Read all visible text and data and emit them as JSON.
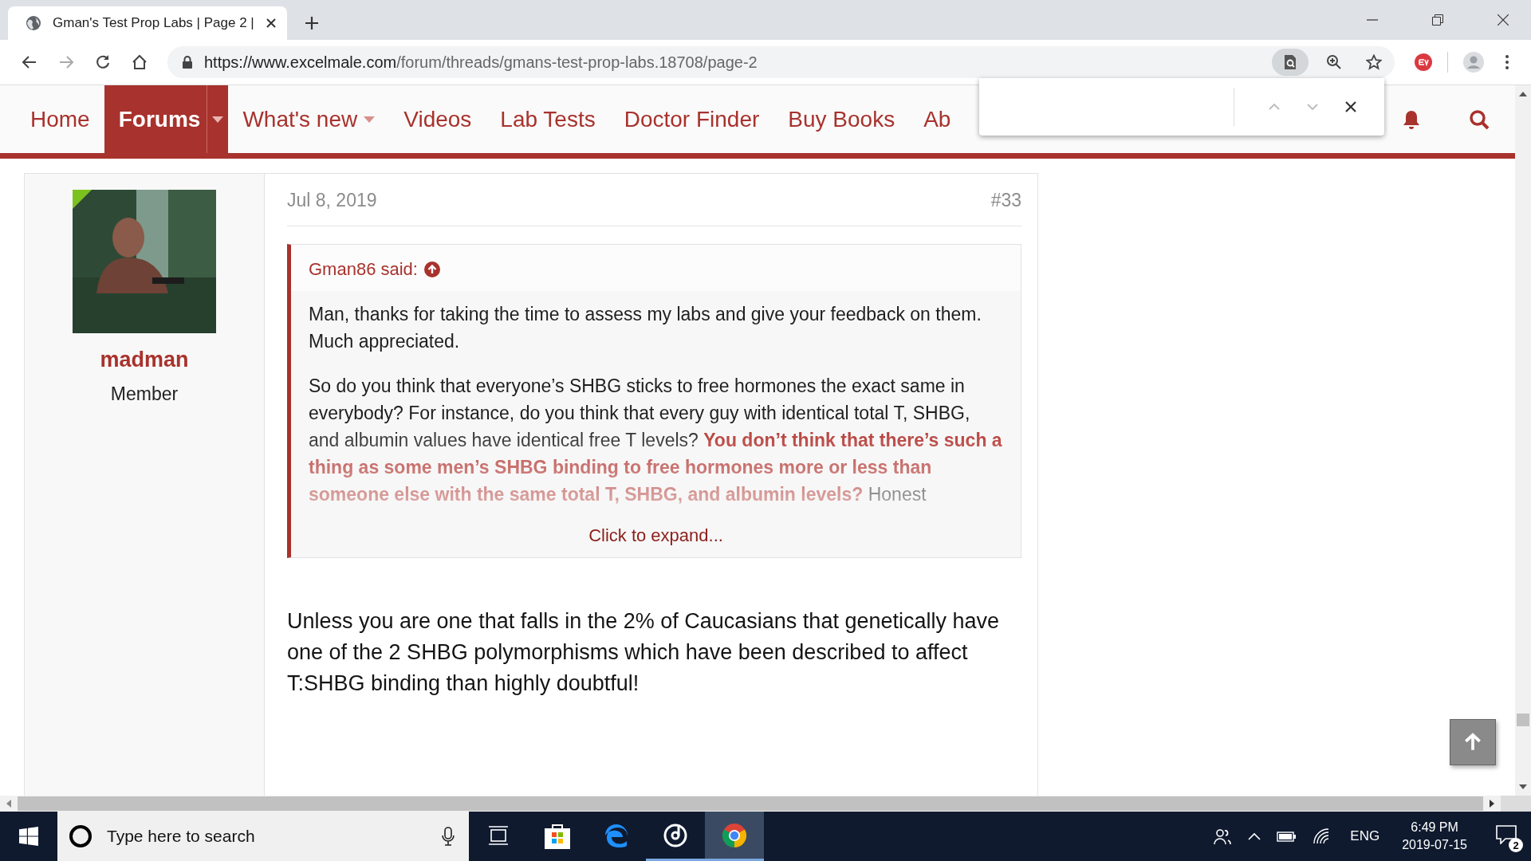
{
  "browser": {
    "tab": {
      "title": "Gman's Test Prop Labs | Page 2 |"
    },
    "address": {
      "host": "https://www.excelmale.com",
      "path": "/forum/threads/gmans-test-prop-labs.18708/page-2"
    }
  },
  "nav": {
    "items": [
      {
        "label": "Home",
        "selected": false,
        "dropdown": false
      },
      {
        "label": "Forums",
        "selected": true,
        "dropdown": true
      },
      {
        "label": "What's new",
        "selected": false,
        "dropdown": true
      },
      {
        "label": "Videos",
        "selected": false,
        "dropdown": false
      },
      {
        "label": "Lab Tests",
        "selected": false,
        "dropdown": false
      },
      {
        "label": "Doctor Finder",
        "selected": false,
        "dropdown": false
      },
      {
        "label": "Buy Books",
        "selected": false,
        "dropdown": false
      },
      {
        "label": "Ab",
        "selected": false,
        "dropdown": false
      }
    ]
  },
  "post": {
    "author": "madman",
    "role": "Member",
    "date": "Jul 8, 2019",
    "number": "#33",
    "quote": {
      "author": "Gman86 said:",
      "paragraphs": [
        "Man, thanks for taking the time to assess my labs and give your feedback on them. Much appreciated.",
        "So do you think that everyone’s SHBG sticks to free hormones the exact same in everybody? For instance, do you think that every guy with identical total T, SHBG, and albumin values have identical free T levels? **You don’t think that there’s such a thing as some men’s SHBG binding to free hormones more or less than someone else with the same total T, SHBG, and albumin levels?** Honest"
      ],
      "expand": "Click to expand..."
    },
    "body": "Unless you are one that falls in the 2% of Caucasians that genetically have one of the 2 SHBG polymorphisms which have been described to affect T:SHBG binding than highly doubtful!"
  },
  "taskbar": {
    "search": {
      "placeholder": "Type here to search"
    },
    "apps": [
      {
        "kind": "taskview",
        "running": false,
        "selected": false
      },
      {
        "kind": "store",
        "running": false,
        "selected": false
      },
      {
        "kind": "edge",
        "running": false,
        "selected": false
      },
      {
        "kind": "groove",
        "running": true,
        "selected": false
      },
      {
        "kind": "chrome",
        "running": true,
        "selected": true
      }
    ],
    "language": "ENG",
    "time": "6:49 PM",
    "date": "2019-07-15",
    "notifications": "2"
  }
}
